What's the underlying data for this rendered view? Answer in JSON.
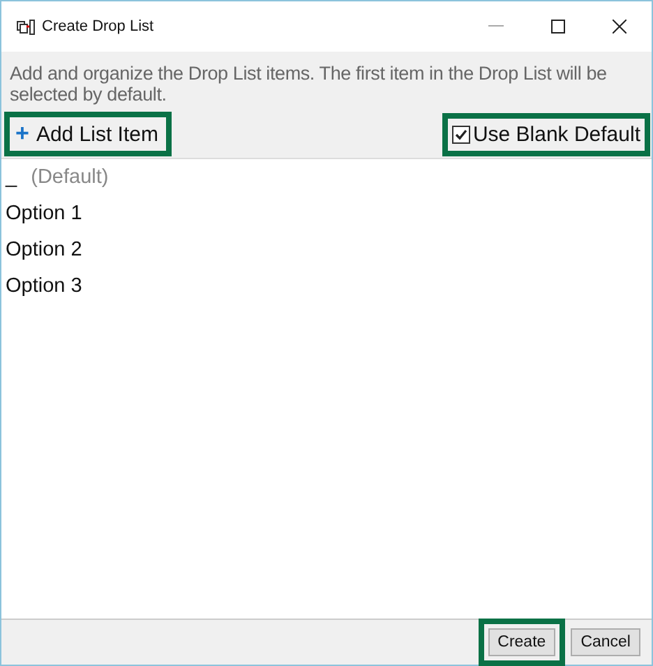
{
  "window": {
    "title": "Create Drop List"
  },
  "description": "Add and organize the Drop List items. The first item in the Drop List will be selected by default.",
  "add_button": {
    "icon": "+",
    "label": "Add List Item",
    "highlighted": true
  },
  "blank_default": {
    "label": "Use Blank Default",
    "checked": true,
    "highlighted": true
  },
  "items": [
    {
      "kind": "placeholder",
      "marker": "_",
      "label": "(Default)"
    },
    {
      "kind": "option",
      "label": "Option 1"
    },
    {
      "kind": "option",
      "label": "Option 2"
    },
    {
      "kind": "option",
      "label": "Option 3"
    }
  ],
  "buttons": [
    {
      "label": "Create",
      "highlighted": true
    },
    {
      "label": "Cancel",
      "highlighted": false
    }
  ]
}
